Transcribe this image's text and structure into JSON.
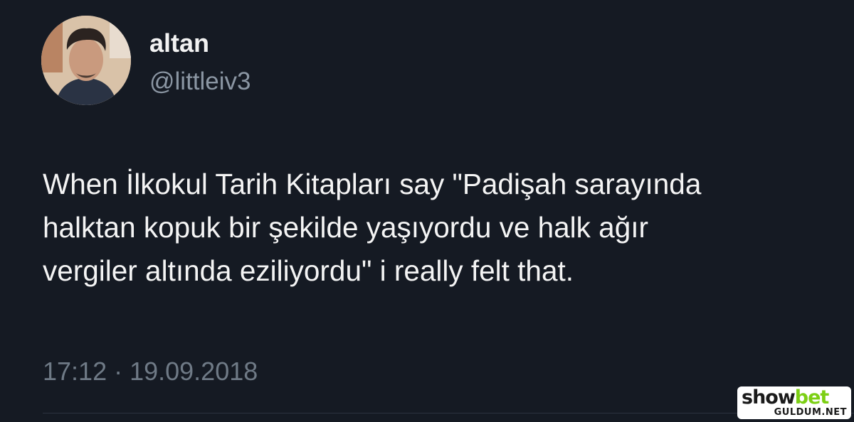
{
  "author": {
    "display_name": "altan",
    "handle": "@littleiv3"
  },
  "tweet": {
    "text": "When İlkokul Tarih Kitapları say \"Padişah sarayında\nhalktan kopuk bir  şekilde yaşıyordu ve halk ağır\nvergiler altında eziliyordu\" i really  felt that.",
    "timestamp": "17:12 · 19.09.2018"
  },
  "watermark": {
    "logo_main": "show",
    "logo_accent": "bet",
    "site": "GULDUM.NET"
  },
  "colors": {
    "background": "#151a23",
    "text": "#f4f4f4",
    "muted": "#8b96a3",
    "watermark_accent": "#7ccf14"
  }
}
